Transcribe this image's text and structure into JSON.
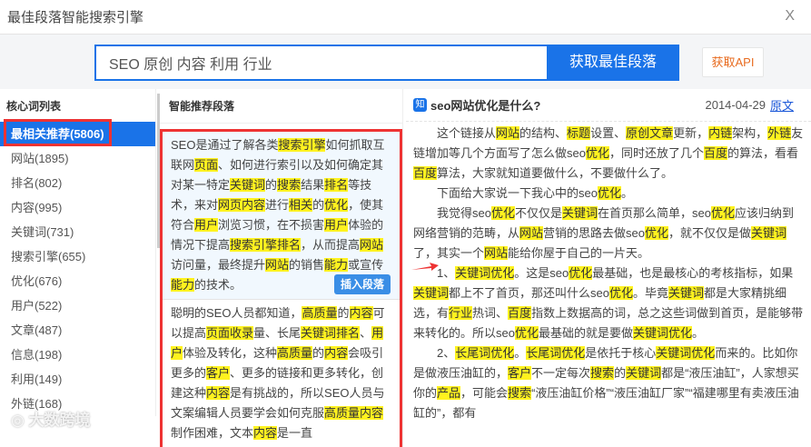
{
  "window": {
    "title": "最佳段落智能搜索引擎",
    "close": "X"
  },
  "search": {
    "value": "SEO 原创 内容 利用 行业",
    "button": "获取最佳段落",
    "api_button": "获取API"
  },
  "sidebar": {
    "header": "核心词列表",
    "items": [
      {
        "label": "最相关推荐(5806)",
        "active": true
      },
      {
        "label": "网站(1895)"
      },
      {
        "label": "排名(802)"
      },
      {
        "label": "内容(995)"
      },
      {
        "label": "关键词(731)"
      },
      {
        "label": "搜索引擎(655)"
      },
      {
        "label": "优化(676)"
      },
      {
        "label": "用户(522)"
      },
      {
        "label": "文章(487)"
      },
      {
        "label": "信息(198)"
      },
      {
        "label": "利用(149)"
      },
      {
        "label": "外链(168)"
      }
    ]
  },
  "middle": {
    "header": "智能推荐段落",
    "insert_label": "插入段落",
    "cards": [
      [
        "SEO是通过了解各类",
        "搜索引擎",
        "如何抓取互联网",
        "页面",
        "、如何进行索引以及如何确定其对某一特定",
        "关键词",
        "的",
        "搜索",
        "结果",
        "排名",
        "等技术，来对",
        "网页内容",
        "进行",
        "相关",
        "的",
        "优化",
        "，使其符合",
        "用户",
        "浏览习惯，在不损害",
        "用户",
        "体验的情况下提高",
        "搜索引擎排名",
        "，从而提高",
        "网站",
        "访问量，最终提升",
        "网站",
        "的销售",
        "能力",
        "或宣传",
        "能力",
        "的技术。"
      ],
      [
        "聪明的SEO人员都知道，",
        "高质量",
        "的",
        "内容",
        "可以提高",
        "页面收录",
        "量、长尾",
        "关键词排名",
        "、",
        "用户",
        "体验及转化，这种",
        "高质量",
        "的",
        "内容",
        "会吸引更多的",
        "客户",
        "、更多的链接和更多转化，创建这种",
        "内容",
        "是有挑战的，所以SEO人员与文案编辑人员要学会如何克服",
        "高质量内容",
        "制作困难，文本",
        "内容",
        "是一直"
      ]
    ]
  },
  "article": {
    "badge": "知",
    "title": "seo网站优化是什么?",
    "date": "2014-04-29",
    "source_link": "原文",
    "paragraphs": [
      [
        "这个链接从",
        "网站",
        "的结构、",
        "标题",
        "设置、",
        "原创文章",
        "更新，",
        "内链",
        "架构，",
        "外链",
        "友链增加等几个方面写了怎么做seo",
        "优化",
        "，同时还放了几个",
        "百度",
        "的算法，看看",
        "百度",
        "算法，大家就知道要做什么，不要做什么了。"
      ],
      [
        "下面给大家说一下我心中的seo",
        "优化",
        "。"
      ],
      [
        "我觉得seo",
        "优化",
        "不仅仅是",
        "关键词",
        "在首页那么简单，seo",
        "优化",
        "应该归纳到网络营销的范畴，从",
        "网站",
        "营销的思路去做seo",
        "优化",
        "，就不仅仅是做",
        "关键词",
        "了，其实一个",
        "网站",
        "能给你屋于自己的一片天。"
      ],
      [
        "1、",
        "关键词优化",
        "。这是seo",
        "优化",
        "最基础，也是最核心的考核指标，如果",
        "关键词",
        "都上不了首页，那还叫什么seo",
        "优化",
        "。毕竟",
        "关键词",
        "都是大家精挑细选，有",
        "行业",
        "热词、",
        "百度",
        "指数上数据高的词，总之这些词做到首页，是能够带来转化的。所以seo",
        "优化",
        "最基础的就是要做",
        "关键词优化",
        "。"
      ],
      [
        "2、",
        "长尾词优化",
        "。",
        "长尾词优化",
        "是依托于核心",
        "关键词优化",
        "而来的。比如你是做液压油缸的，",
        "客户",
        "不一定每次",
        "搜索",
        "的",
        "关键词",
        "都是“液压油缸”，人家想买你的",
        "产品",
        "，可能会",
        "搜索",
        "“液压油缸价格”“液压油缸厂家”“福建哪里有卖液压油缸的”，都有"
      ]
    ]
  },
  "watermark": "大数跨境",
  "colors": {
    "accent": "#1a73e8",
    "highlight": "#fff21f",
    "annotation": "#e33333",
    "api": "#e86b1f"
  }
}
